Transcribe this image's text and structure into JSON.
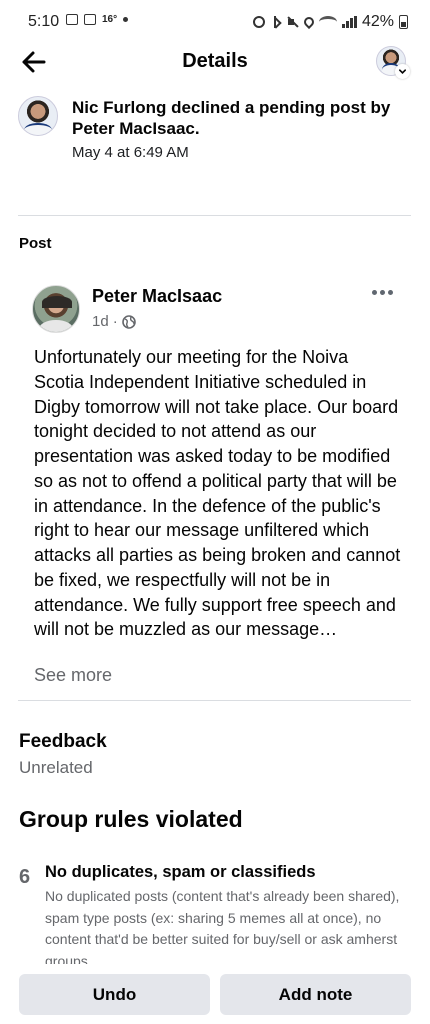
{
  "status_bar": {
    "time": "5:10",
    "temperature": "16°",
    "battery": "42%",
    "icons": [
      "image-icon",
      "calendar-icon",
      "dot-icon",
      "alarm-icon",
      "bluetooth-icon",
      "mute-icon",
      "location-icon",
      "wifi-icon",
      "signal-icon",
      "battery-icon"
    ]
  },
  "header": {
    "title": "Details",
    "back_icon": "arrow-left-icon",
    "profile_icon": "avatar-icon"
  },
  "activity": {
    "text": "Nic Furlong declined a pending post by Peter MacIsaac.",
    "time": "May 4 at 6:49 AM"
  },
  "post": {
    "section_label": "Post",
    "author": "Peter MacIsaac",
    "age": "1d",
    "audience_icon": "globe-icon",
    "body": "Unfortunately  our meeting for the Noiva Scotia Independent Initiative scheduled in Digby tomorrow will not take place. Our board  tonight decided to not attend as our presentation was asked today to be modified so as not to offend a political party that will be in  attendance. In the defence of the public's right to hear our message  unfiltered which attacks all parties as being broken and cannot be fixed, we respectfully will not be in attendance. We fully support free  speech and will not be muzzled as our message…",
    "see_more": "See more"
  },
  "feedback": {
    "title": "Feedback",
    "value": "Unrelated"
  },
  "rules": {
    "title": "Group rules violated",
    "items": [
      {
        "number": "6",
        "title": "No duplicates, spam or classifieds",
        "description": "No duplicated posts (content that's already been shared), spam type posts (ex: sharing 5 memes all at once), no content that'd be better suited for buy/sell or ask amherst groups"
      }
    ]
  },
  "actions": {
    "undo": "Undo",
    "add_note": "Add note"
  },
  "colors": {
    "text": "#050505",
    "secondary": "#65676b",
    "button_bg": "#e4e6eb",
    "divider": "#dadde1"
  }
}
